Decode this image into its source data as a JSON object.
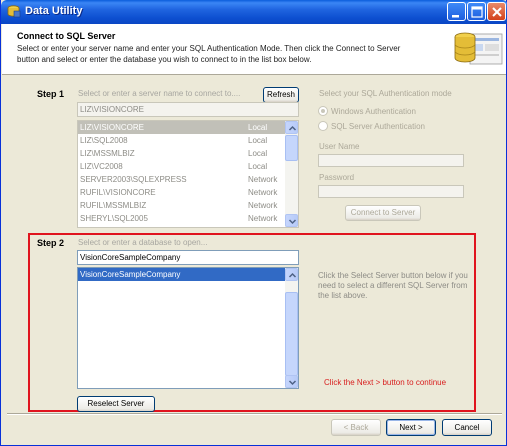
{
  "window": {
    "title": "Data Utility"
  },
  "header": {
    "title": "Connect to SQL Server",
    "description": "Select or enter your server name and enter your SQL Authentication Mode.  Then click the Connect to Server button and select or enter the database you wish to connect to in the list box below."
  },
  "step1": {
    "label": "Step 1",
    "hint": "Select or enter a server name to connect to....",
    "refresh_label": "Refresh",
    "server_value": "LIZ\\VISIONCORE",
    "servers": [
      {
        "name": "LIZ\\VISIONCORE",
        "type": "Local",
        "selected": true
      },
      {
        "name": "LIZ\\SQL2008",
        "type": "Local"
      },
      {
        "name": "LIZ\\MSSMLBIZ",
        "type": "Local"
      },
      {
        "name": "LIZ\\VC2008",
        "type": "Local"
      },
      {
        "name": "SERVER2003\\SQLEXPRESS",
        "type": "Network"
      },
      {
        "name": "RUFIL\\VISIONCORE",
        "type": "Network"
      },
      {
        "name": "RUFIL\\MSSMLBIZ",
        "type": "Network"
      },
      {
        "name": "SHERYL\\SQL2005",
        "type": "Network"
      }
    ]
  },
  "auth": {
    "heading": "Select your SQL Authentication mode",
    "windows_label": "Windows Authentication",
    "sql_label": "SQL Server Authentication",
    "windows_checked": true,
    "username_label": "User Name",
    "password_label": "Password",
    "connect_label": "Connect to Server"
  },
  "step2": {
    "label": "Step 2",
    "hint": "Select or enter a database to open...",
    "database_value": "VisionCoreSampleCompany",
    "databases": [
      {
        "name": "VisionCoreSampleCompany",
        "selected": true
      }
    ],
    "info": "Click the Select Server button below if you need to select a different SQL Server from the list above.",
    "reselect_label": "Reselect Server",
    "next_hint": "Click the Next > button to continue"
  },
  "footer": {
    "back_label": "< Back",
    "next_label": "Next >",
    "cancel_label": "Cancel"
  },
  "colors": {
    "title_bar": "#0a5ddb",
    "dialog_bg": "#ece9d8",
    "highlight": "#e0141e",
    "selection": "#316ac5"
  }
}
